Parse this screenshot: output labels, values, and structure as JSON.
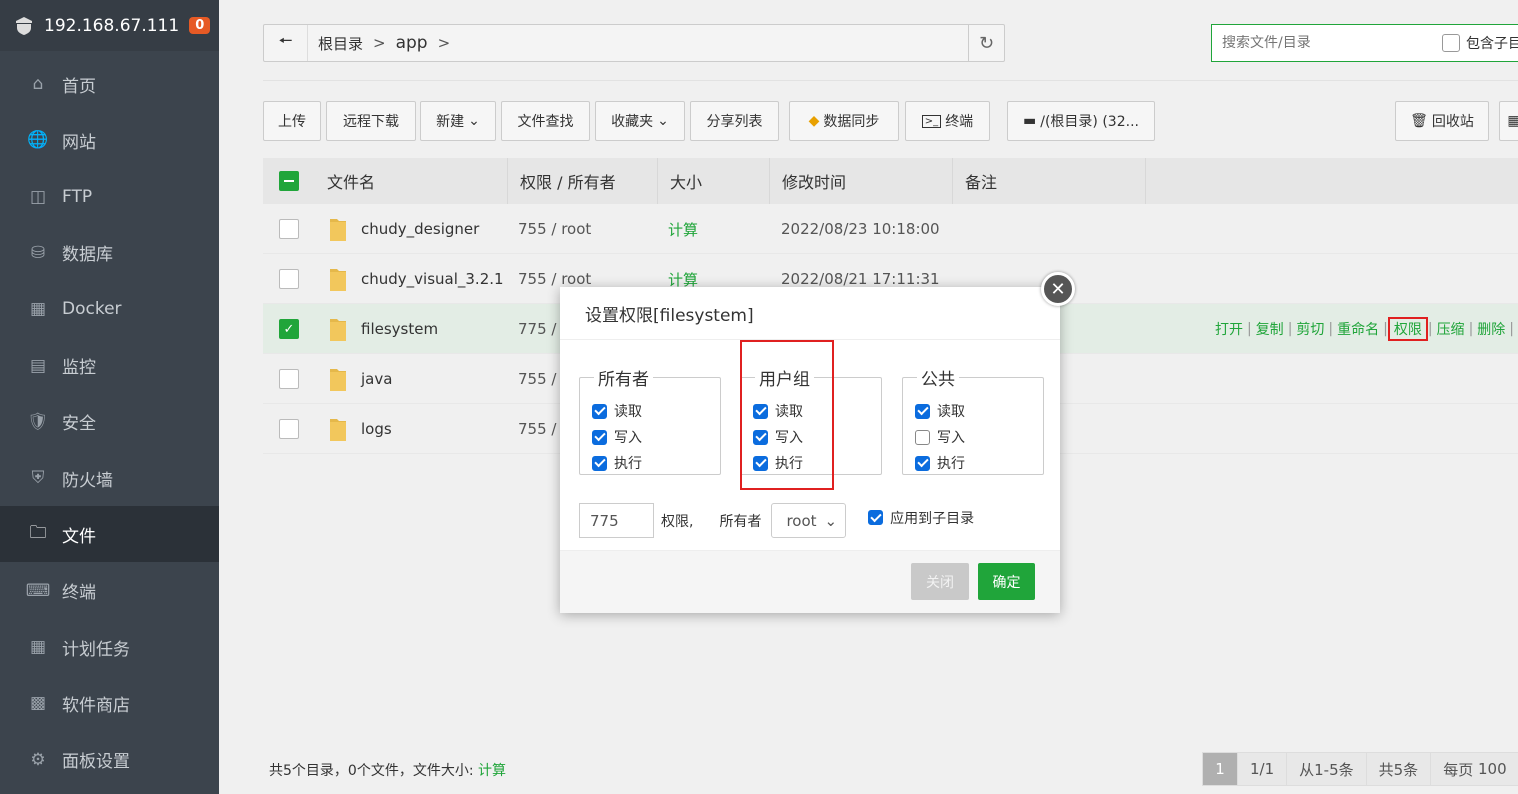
{
  "sidebar": {
    "host": "192.168.67.111",
    "badge": "0",
    "items": [
      {
        "label": "首页",
        "icon": "home-icon"
      },
      {
        "label": "网站",
        "icon": "globe-icon"
      },
      {
        "label": "FTP",
        "icon": "ftp-icon"
      },
      {
        "label": "数据库",
        "icon": "database-icon"
      },
      {
        "label": "Docker",
        "icon": "docker-icon"
      },
      {
        "label": "监控",
        "icon": "monitor-icon"
      },
      {
        "label": "安全",
        "icon": "shield-icon"
      },
      {
        "label": "防火墙",
        "icon": "firewall-icon"
      },
      {
        "label": "文件",
        "icon": "folder-icon"
      },
      {
        "label": "终端",
        "icon": "terminal-icon"
      },
      {
        "label": "计划任务",
        "icon": "calendar-icon"
      },
      {
        "label": "软件商店",
        "icon": "apps-icon"
      },
      {
        "label": "面板设置",
        "icon": "gear-icon"
      }
    ],
    "active": "文件"
  },
  "path": {
    "root": "根目录",
    "dir": "app",
    "sep": ">"
  },
  "search": {
    "placeholder": "搜索文件/目录",
    "sub_label": "包含子目"
  },
  "toolbar": {
    "upload": "上传",
    "remote": "远程下载",
    "new": "新建",
    "find": "文件查找",
    "fav": "收藏夹",
    "share": "分享列表",
    "sync": "数据同步",
    "terminal": "终端",
    "disk": "/(根目录) (32...",
    "recycle": "回收站"
  },
  "table": {
    "headers": {
      "name": "文件名",
      "perm": "权限 / 所有者",
      "size": "大小",
      "mtime": "修改时间",
      "note": "备注"
    },
    "rows": [
      {
        "name": "chudy_designer",
        "perm": "755 / root",
        "size": "计算",
        "mtime": "2022/08/23 10:18:00"
      },
      {
        "name": "chudy_visual_3.2.1",
        "perm": "755 / root",
        "size": "计算",
        "mtime": "2022/08/21 17:11:31"
      },
      {
        "name": "filesystem",
        "perm": "775 /",
        "size": "",
        "mtime": ""
      },
      {
        "name": "java",
        "perm": "755 /",
        "size": "",
        "mtime": ""
      },
      {
        "name": "logs",
        "perm": "755 /",
        "size": "",
        "mtime": ""
      }
    ],
    "ops": [
      "打开",
      "复制",
      "剪切",
      "重命名",
      "权限",
      "压缩",
      "删除"
    ]
  },
  "footer": {
    "summary": "共5个目录，0个文件，文件大小:",
    "calc": "计算"
  },
  "pager": {
    "page": "1",
    "of": "1/1",
    "range": "从1-5条",
    "total": "共5条",
    "per": "每页",
    "per_val": "100"
  },
  "modal": {
    "title": "设置权限[filesystem]",
    "groups": [
      {
        "label": "所有者",
        "read": "读取",
        "write": "写入",
        "exec": "执行",
        "r": true,
        "w": true,
        "x": true
      },
      {
        "label": "用户组",
        "read": "读取",
        "write": "写入",
        "exec": "执行",
        "r": true,
        "w": true,
        "x": true
      },
      {
        "label": "公共",
        "read": "读取",
        "write": "写入",
        "exec": "执行",
        "r": true,
        "w": false,
        "x": true
      }
    ],
    "mode": "775",
    "perm_label": "权限,",
    "owner_label": "所有者",
    "owner_value": "root",
    "apply_sub": "应用到子目录",
    "close": "关闭",
    "confirm": "确定"
  },
  "colors": {
    "accent": "#20a53a",
    "sidebar": "#3c444d",
    "highlight": "#e02020",
    "checkbox": "#0b6cde"
  }
}
